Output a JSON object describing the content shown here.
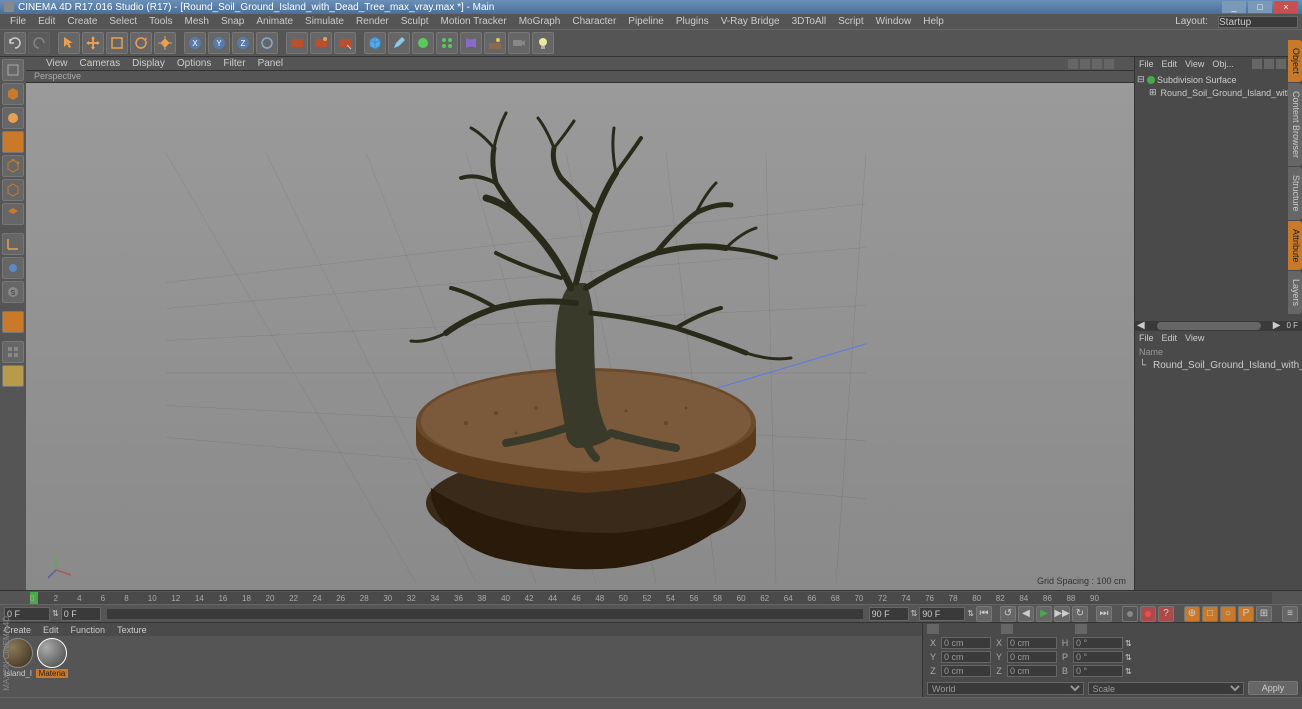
{
  "titlebar": {
    "text": "CINEMA 4D R17.016 Studio (R17) - [Round_Soil_Ground_Island_with_Dead_Tree_max_vray.max *] - Main"
  },
  "window_buttons": {
    "min": "_",
    "max": "□",
    "close": "×"
  },
  "menubar": {
    "items": [
      "File",
      "Edit",
      "Create",
      "Select",
      "Tools",
      "Mesh",
      "Snap",
      "Animate",
      "Simulate",
      "Render",
      "Sculpt",
      "Motion Tracker",
      "MoGraph",
      "Character",
      "Pipeline",
      "Plugins",
      "V-Ray Bridge",
      "3DToAll",
      "Script",
      "Window",
      "Help"
    ],
    "layout_label": "Layout:",
    "layout_value": "Startup"
  },
  "viewport": {
    "menu": [
      "View",
      "Cameras",
      "Display",
      "Options",
      "Filter",
      "Panel"
    ],
    "label": "Perspective",
    "grid_spacing": "Grid Spacing : 100 cm"
  },
  "objects_panel": {
    "tabs": [
      "File",
      "Edit",
      "View",
      "Obj..."
    ],
    "items": [
      {
        "name": "Subdivision Surface",
        "indent": 0
      },
      {
        "name": "Round_Soil_Ground_Island_with_Dead",
        "indent": 1
      }
    ]
  },
  "layers_panel": {
    "tabs": [
      "File",
      "Edit",
      "View"
    ],
    "header": "Name",
    "items": [
      "Round_Soil_Ground_Island_with_Dead"
    ]
  },
  "side_tabs": [
    "Object",
    "Content Browser",
    "Structure",
    "Attribute",
    "Layers"
  ],
  "timeline": {
    "start": 0,
    "end": 90,
    "step": 2,
    "frame_field_left": "0 F",
    "frame_field_mid": "0 F",
    "frame_field_r1": "90 F",
    "frame_field_r2": "90 F"
  },
  "materials": {
    "tabs": [
      "Create",
      "Edit",
      "Function",
      "Texture"
    ],
    "items": [
      {
        "label": "Island_I",
        "selected": false
      },
      {
        "label": "Materia",
        "selected": true
      }
    ]
  },
  "coords": {
    "rows": [
      {
        "l1": "X",
        "v1": "0 cm",
        "l2": "X",
        "v2": "0 cm",
        "l3": "H",
        "v3": "0 °"
      },
      {
        "l1": "Y",
        "v1": "0 cm",
        "l2": "Y",
        "v2": "0 cm",
        "l3": "P",
        "v3": "0 °"
      },
      {
        "l1": "Z",
        "v1": "0 cm",
        "l2": "Z",
        "v2": "0 cm",
        "l3": "B",
        "v3": "0 °"
      }
    ],
    "mode1": "World",
    "mode2": "Scale",
    "apply": "Apply"
  },
  "logo": "MAXON  CINEMA 4D"
}
